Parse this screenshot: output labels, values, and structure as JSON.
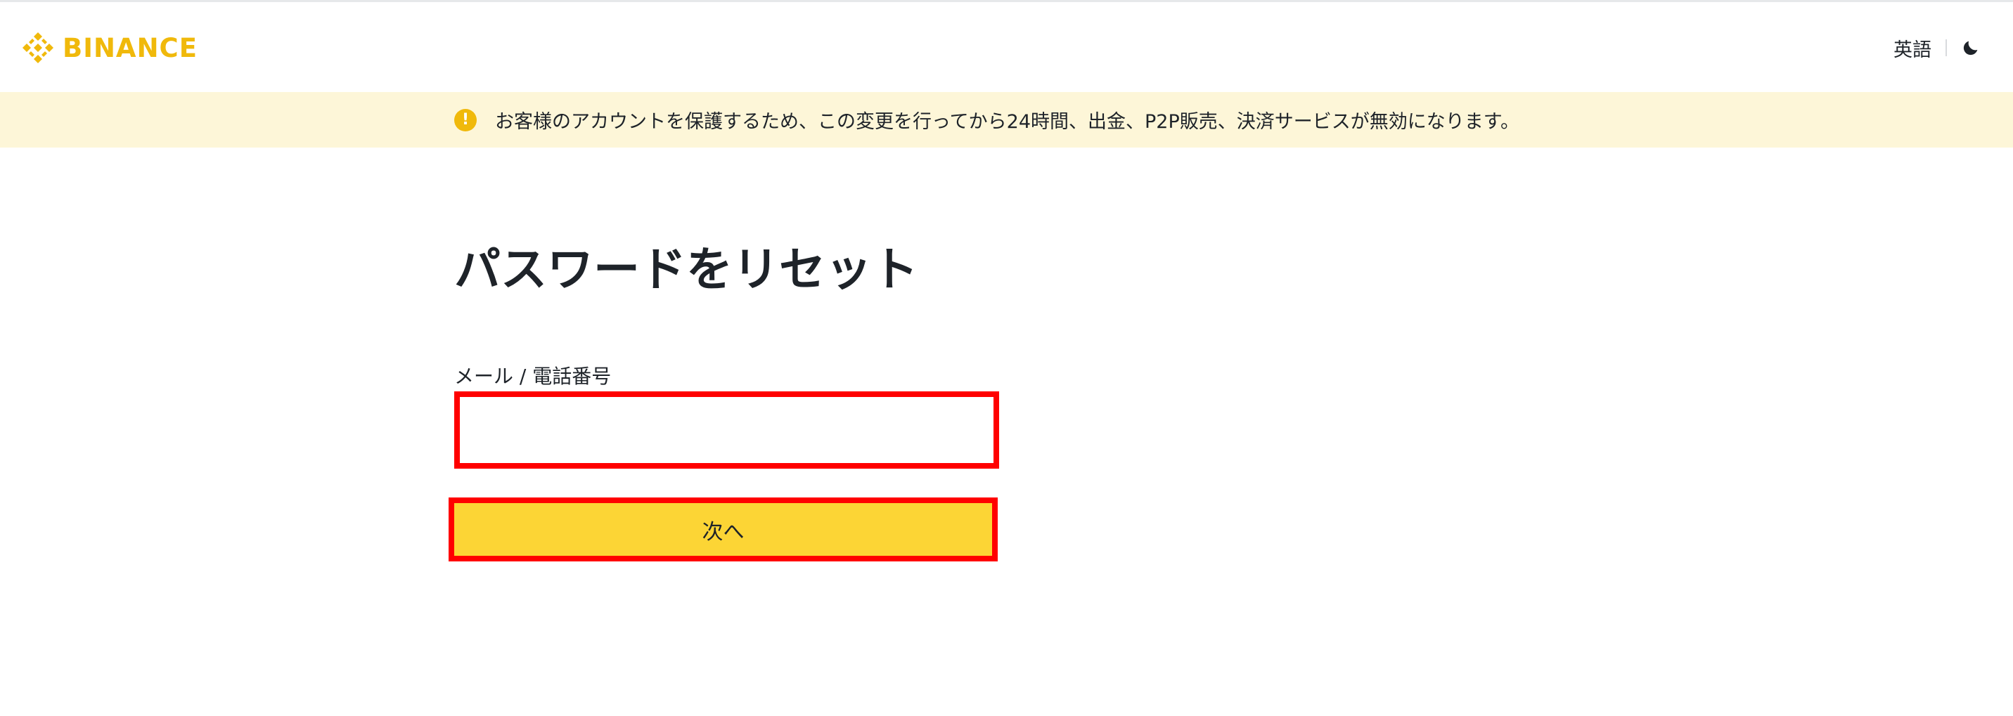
{
  "header": {
    "logo_text": "BINANCE",
    "logo_icon": "binance-logo-icon",
    "language_label": "英語",
    "theme_icon": "moon-icon"
  },
  "banner": {
    "icon": "exclamation-circle-icon",
    "icon_glyph": "!",
    "text": "お客様のアカウントを保護するため、この変更を行ってから24時間、出金、P2P販売、決済サービスが無効になります。"
  },
  "form": {
    "title": "パスワードをリセット",
    "field_label": "メール / 電話番号",
    "input_value": "",
    "input_placeholder": "",
    "next_label": "次へ"
  },
  "colors": {
    "brand": "#f0b90b",
    "button": "#fcd535",
    "banner_bg": "#fdf6d8",
    "highlight": "#ff0000"
  }
}
